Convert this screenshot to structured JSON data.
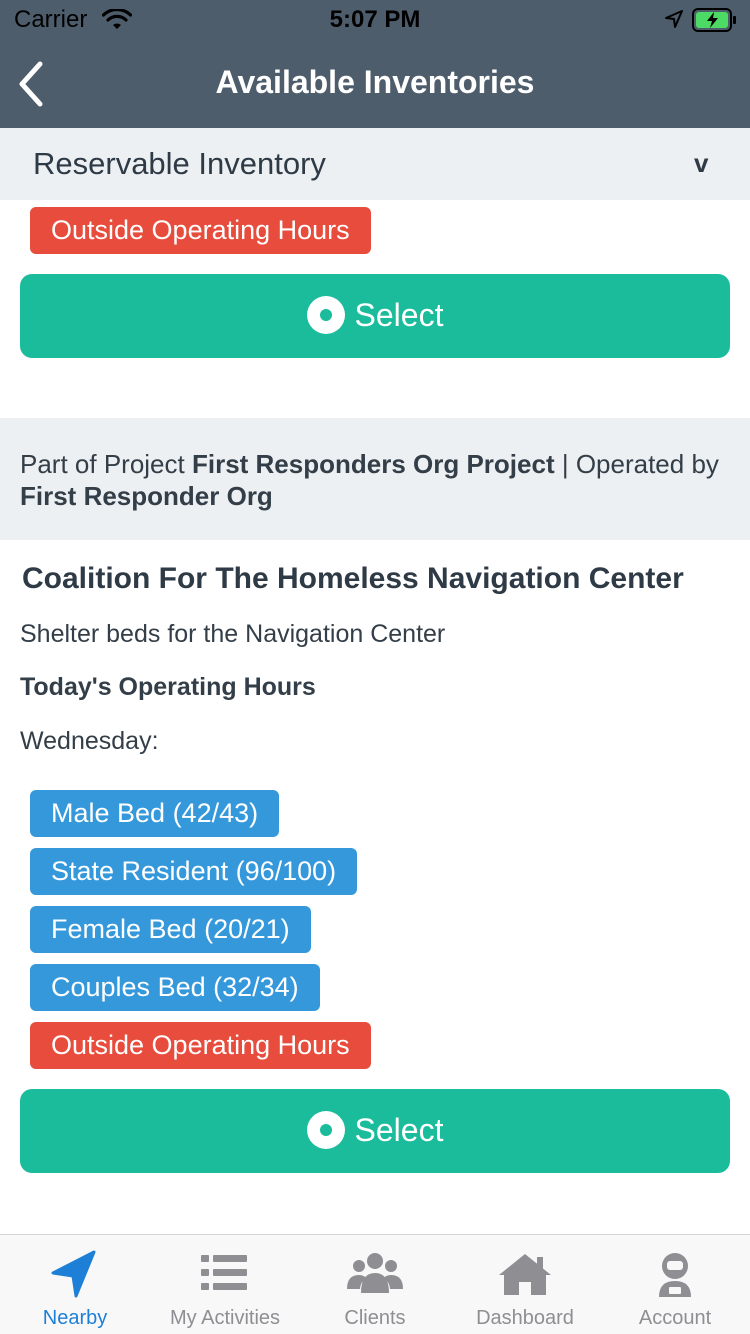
{
  "status_bar": {
    "carrier": "Carrier",
    "time": "5:07 PM"
  },
  "nav": {
    "title": "Available Inventories"
  },
  "dropdown": {
    "label": "Reservable Inventory",
    "chevron": "v"
  },
  "first_card": {
    "status_badge": "Outside Operating Hours",
    "select_label": "Select"
  },
  "project": {
    "prefix": "Part of Project ",
    "project_name": "First Responders Org Project",
    "middle": " | Operated by ",
    "operator": "First Responder Org"
  },
  "second_card": {
    "title": "Coalition For The Homeless Navigation Center",
    "description": "Shelter beds for the Navigation Center",
    "hours_heading": "Today's Operating Hours",
    "day": "Wednesday:",
    "inventories": [
      "Male Bed (42/43)",
      "State Resident (96/100)",
      "Female Bed (20/21)",
      "Couples Bed (32/34)"
    ],
    "status_badge": "Outside Operating Hours",
    "select_label": "Select"
  },
  "tabs": [
    {
      "label": "Nearby",
      "icon": "navigation-arrow-icon",
      "active": true
    },
    {
      "label": "My Activities",
      "icon": "list-icon",
      "active": false
    },
    {
      "label": "Clients",
      "icon": "users-icon",
      "active": false
    },
    {
      "label": "Dashboard",
      "icon": "home-icon",
      "active": false
    },
    {
      "label": "Account",
      "icon": "astronaut-icon",
      "active": false
    }
  ],
  "colors": {
    "header": "#4e5d6c",
    "accent": "#1abc9c",
    "danger": "#e74c3c",
    "info": "#3498db",
    "tab_active": "#1e7fd6"
  }
}
